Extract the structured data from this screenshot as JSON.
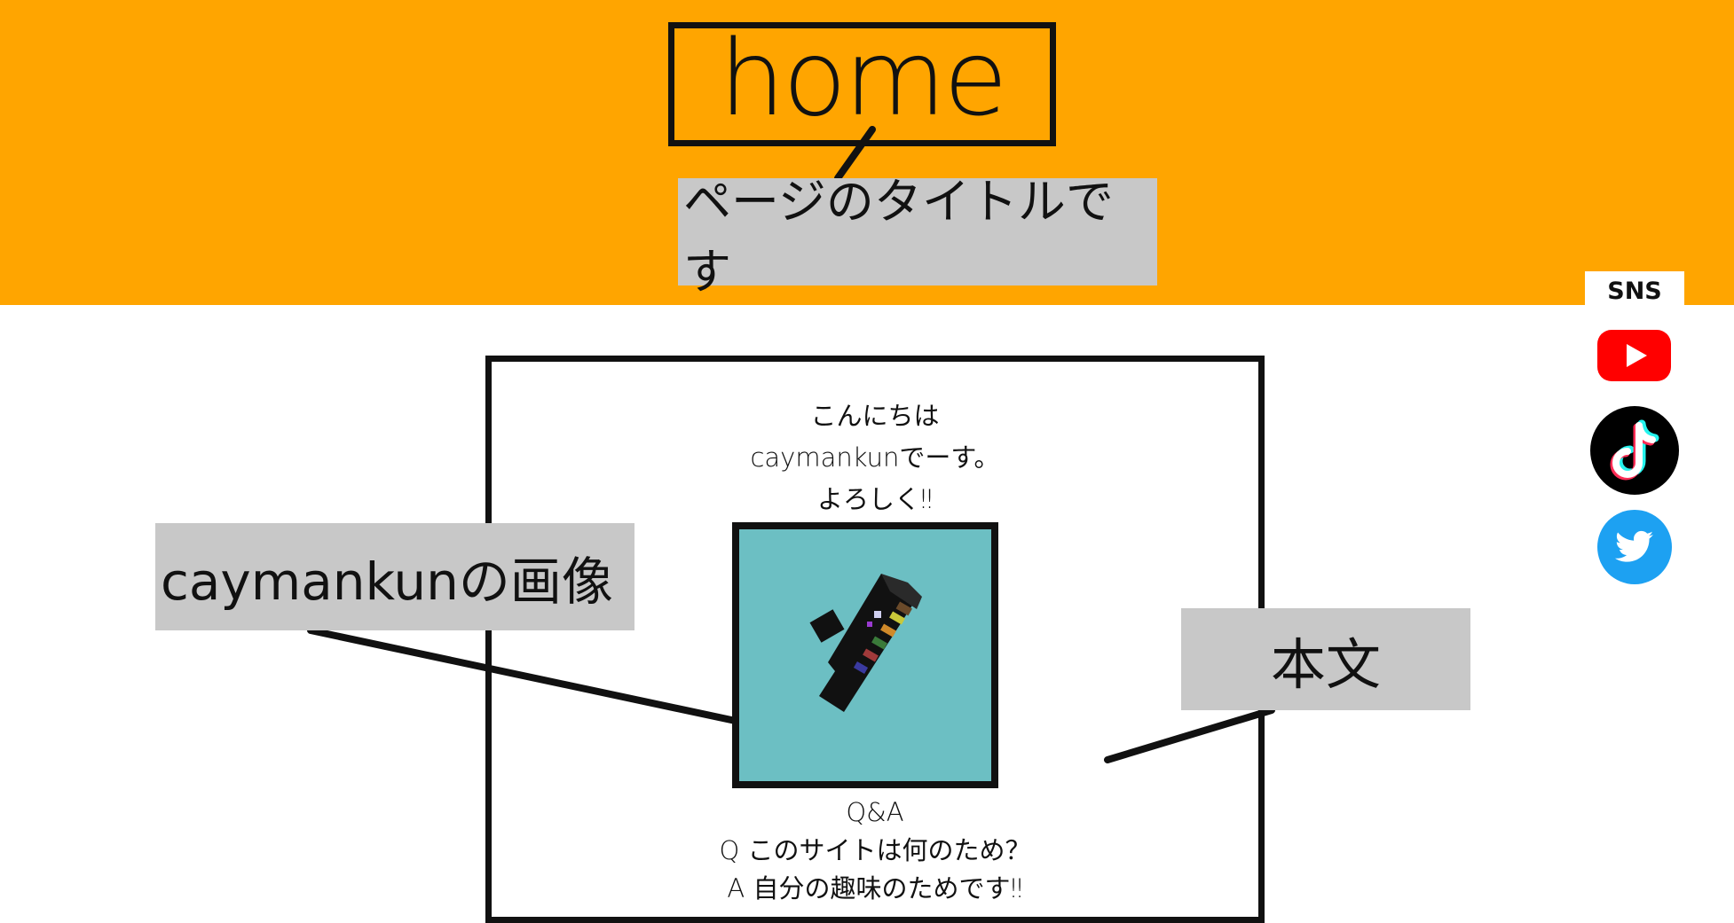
{
  "header": {
    "home_label": "home",
    "title_callout": "ページのタイトルです"
  },
  "main": {
    "greeting_lines": [
      "こんにちは",
      "caymankunでーす。",
      "よろしく‼"
    ],
    "avatar_callout": "caymankunの画像",
    "body_callout": "本文",
    "qa_lines": [
      "Q&A",
      "Q このサイトは何のため？",
      "A 自分の趣味のためです‼"
    ]
  },
  "sns": {
    "label": "SNS",
    "icons": [
      "youtube-icon",
      "tiktok-icon",
      "twitter-icon"
    ]
  },
  "colors": {
    "header_bg": "#FFA500",
    "callout_bg": "#c8c8c8",
    "avatar_bg": "#6cbfc3",
    "youtube": "#FF0000",
    "tiktok": "#000000",
    "twitter": "#1DA1F2"
  }
}
